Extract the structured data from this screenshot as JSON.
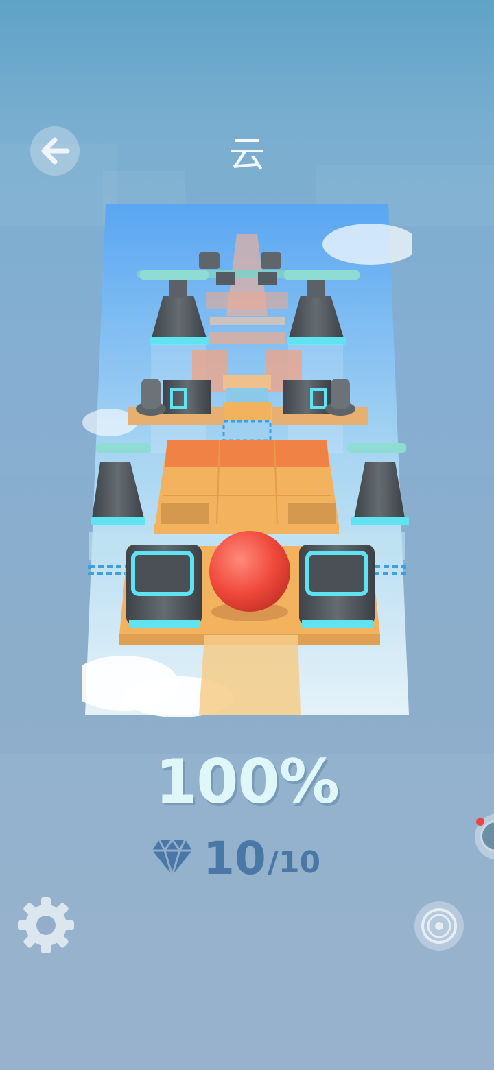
{
  "header": {
    "title": "云",
    "back_icon": "arrow-left-icon"
  },
  "level_preview": {
    "image": "level-preview-image"
  },
  "progress": {
    "percent_text": "100%",
    "value": 100
  },
  "gems": {
    "icon": "diamond-icon",
    "collected": "10",
    "total": "/10"
  },
  "controls": {
    "settings_icon": "gear-icon",
    "music_icon": "disc-icon",
    "side_widget_icon": "floating-widget-icon"
  },
  "colors": {
    "background_top": "#5fa3c7",
    "background_bottom": "#93aecb",
    "percent_text": "#dff7f9",
    "gem_text": "#4a78a6",
    "ball": "#f04a3c",
    "tile": "#f2b25e",
    "block": "#4b5157",
    "accent": "#5fe3f0"
  }
}
